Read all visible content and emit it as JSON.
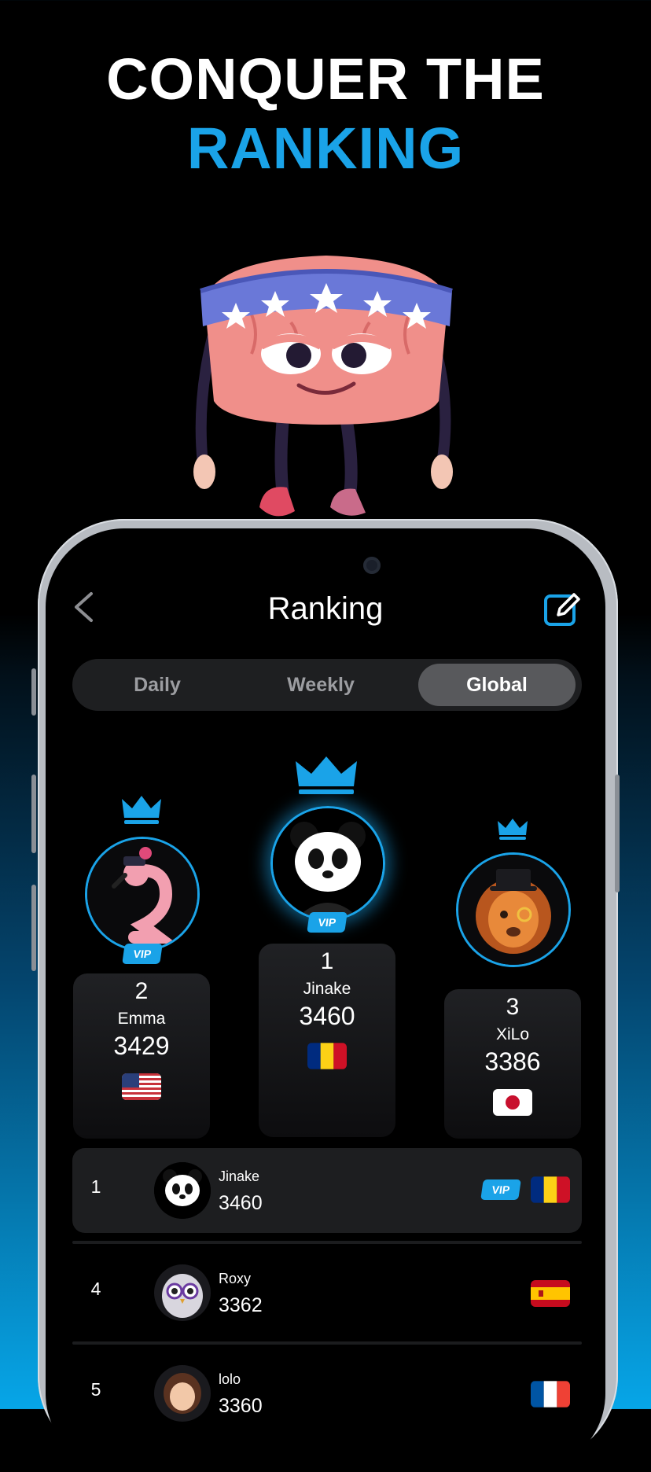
{
  "hero": {
    "line1": "CONQUER THE",
    "line2": "RANKING"
  },
  "colors": {
    "accent": "#1aa3e8",
    "tab_active": "#58595c",
    "card_bg": "#1d1e20"
  },
  "header": {
    "title": "Ranking",
    "back_icon": "chevron-left-icon",
    "edit_icon": "edit-icon"
  },
  "tabs": [
    {
      "label": "Daily",
      "active": false
    },
    {
      "label": "Weekly",
      "active": false
    },
    {
      "label": "Global",
      "active": true
    }
  ],
  "podium": {
    "first": {
      "rank": "1",
      "name": "Jinake",
      "score": "3460",
      "country": "romania-flag",
      "vip": "VIP"
    },
    "second": {
      "rank": "2",
      "name": "Emma",
      "score": "3429",
      "country": "usa-flag",
      "vip": "VIP"
    },
    "third": {
      "rank": "3",
      "name": "XiLo",
      "score": "3386",
      "country": "japan-flag"
    }
  },
  "list": [
    {
      "rank": "1",
      "name": "Jinake",
      "score": "3460",
      "vip": "VIP",
      "country": "romania-flag"
    },
    {
      "rank": "4",
      "name": "Roxy",
      "score": "3362",
      "country": "spain-flag"
    },
    {
      "rank": "5",
      "name": "lolo",
      "score": "3360",
      "country": "france-flag"
    }
  ]
}
